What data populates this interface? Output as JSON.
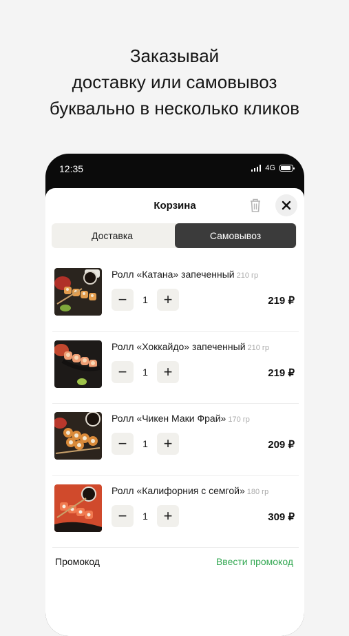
{
  "headline": {
    "line1": "Заказывай",
    "line2": "доставку или самовывоз",
    "line3": "буквально в несколько кликов"
  },
  "status_bar": {
    "time": "12:35",
    "network": "4G",
    "battery_level": 0.9
  },
  "cart": {
    "title": "Корзина",
    "trash_icon": "trash-icon",
    "close_icon": "close-icon",
    "tabs": [
      {
        "label": "Доставка",
        "selected": false
      },
      {
        "label": "Самовывоз",
        "selected": true
      }
    ],
    "items": [
      {
        "name": "Ролл «Катана» запеченный",
        "weight": "210 гр",
        "qty": "1",
        "price": "219 ₽",
        "minus": "−",
        "plus": "+"
      },
      {
        "name": "Ролл «Хоккайдо» запеченный",
        "weight": "210 гр",
        "qty": "1",
        "price": "219 ₽",
        "minus": "−",
        "plus": "+"
      },
      {
        "name": "Ролл «Чикен Маки Фрай»",
        "weight": "170 гр",
        "qty": "1",
        "price": "209 ₽",
        "minus": "−",
        "plus": "+"
      },
      {
        "name": "Ролл «Калифорния с семгой»",
        "weight": "180 гр",
        "qty": "1",
        "price": "309 ₽",
        "minus": "−",
        "plus": "+"
      }
    ],
    "promo": {
      "label": "Промокод",
      "action": "Ввести промокод"
    }
  },
  "colors": {
    "accent_green": "#34a853",
    "segment_selected": "#3b3b3b",
    "phone_frame": "#0b0b0b"
  }
}
